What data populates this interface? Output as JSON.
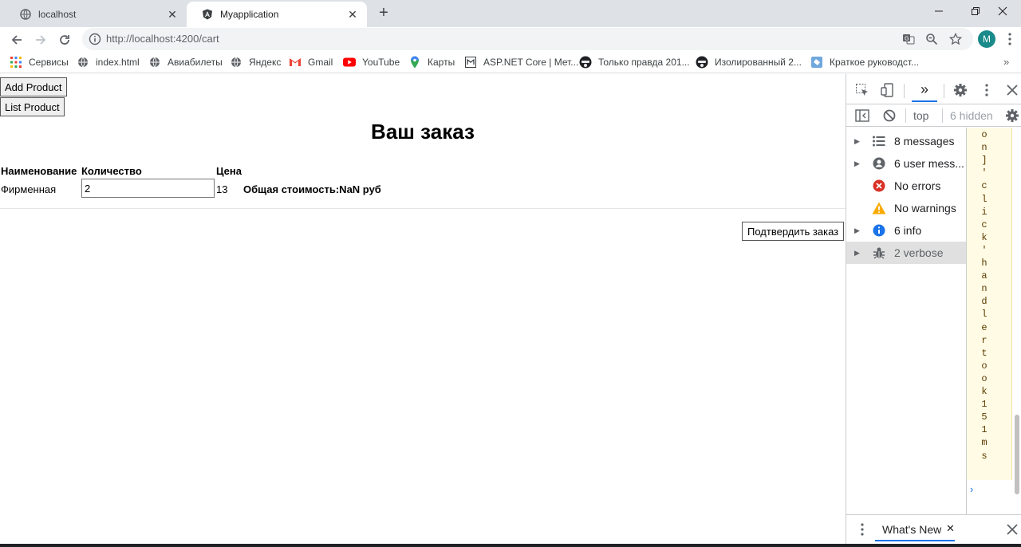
{
  "browser": {
    "tabs": [
      {
        "title": "localhost",
        "active": false
      },
      {
        "title": "Myapplication",
        "active": true
      }
    ],
    "url": "http://localhost:4200/cart",
    "profile_initial": "M",
    "bookmarks": [
      {
        "label": "Сервисы",
        "icon": "apps-grid-icon"
      },
      {
        "label": "index.html",
        "icon": "globe-icon"
      },
      {
        "label": "Авиабилеты",
        "icon": "globe-icon"
      },
      {
        "label": "Яндекс",
        "icon": "globe-icon"
      },
      {
        "label": "Gmail",
        "icon": "gmail-icon"
      },
      {
        "label": "YouTube",
        "icon": "youtube-icon"
      },
      {
        "label": "Карты",
        "icon": "maps-pin-icon"
      },
      {
        "label": "ASP.NET Core | Мет...",
        "icon": "doc-icon"
      },
      {
        "label": "Только правда 201...",
        "icon": "avatar-icon"
      },
      {
        "label": "Изолированный 2...",
        "icon": "avatar-icon"
      },
      {
        "label": "Краткое руководст...",
        "icon": "puzzle-icon"
      }
    ]
  },
  "page": {
    "buttons": {
      "add_product": "Add Product",
      "list_product": "List Product"
    },
    "title": "Ваш заказ",
    "table": {
      "headers": [
        "Наименование",
        "Количество",
        "Цена"
      ],
      "row": {
        "name": "Фирменная",
        "quantity": "2",
        "price": "13"
      }
    },
    "total_label": "Общая стоимость:NaN руб",
    "confirm_button": "Подтвердить заказ"
  },
  "devtools": {
    "context": "top",
    "hidden_count": "6 hidden",
    "sidebar": [
      {
        "label": "8 messages",
        "icon": "list-icon",
        "color": "#5f6368",
        "expandable": true,
        "selected": false
      },
      {
        "label": "6 user mess...",
        "icon": "user-icon",
        "color": "#5f6368",
        "expandable": true,
        "selected": false
      },
      {
        "label": "No errors",
        "icon": "error-icon",
        "color": "#d93025",
        "expandable": false,
        "selected": false
      },
      {
        "label": "No warnings",
        "icon": "warning-icon",
        "color": "#f9ab00",
        "expandable": false,
        "selected": false
      },
      {
        "label": "6 info",
        "icon": "info-icon",
        "color": "#1a73e8",
        "expandable": true,
        "selected": false
      },
      {
        "label": "2 verbose",
        "icon": "bug-icon",
        "color": "#5f6368",
        "expandable": true,
        "selected": true
      }
    ],
    "log_chars": [
      "o",
      "n",
      "]",
      "'",
      "c",
      "l",
      "i",
      "c",
      "k",
      "'",
      "h",
      "a",
      "n",
      "d",
      "l",
      "e",
      "r",
      "t",
      "o",
      "o",
      "k",
      "1",
      "5",
      "1",
      "m",
      "s"
    ],
    "drawer_tab": "What's New"
  }
}
